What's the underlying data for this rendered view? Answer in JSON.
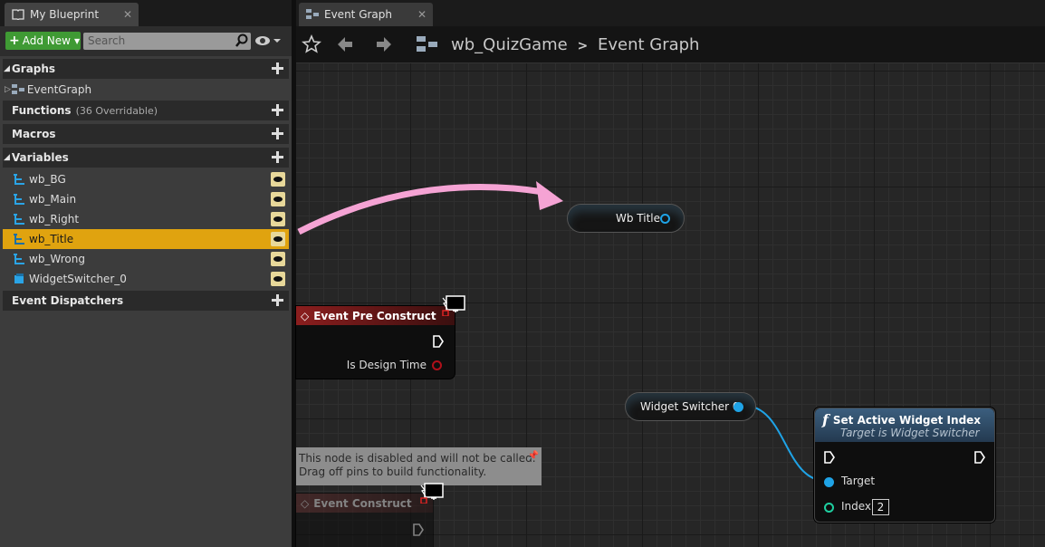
{
  "left_panel": {
    "tab_title": "My Blueprint",
    "add_new_label": "Add New",
    "search_placeholder": "Search",
    "categories": {
      "graphs": "Graphs",
      "functions": "Functions",
      "functions_overridable": "(36 Overridable)",
      "macros": "Macros",
      "variables": "Variables",
      "event_dispatchers": "Event Dispatchers"
    },
    "graph_items": [
      "EventGraph"
    ],
    "variables": [
      "wb_BG",
      "wb_Main",
      "wb_Right",
      "wb_Title",
      "wb_Wrong",
      "WidgetSwitcher_0"
    ],
    "selected_variable": "wb_Title"
  },
  "graph_tab": {
    "title": "Event Graph"
  },
  "breadcrumb": {
    "blueprint": "wb_QuizGame",
    "separator": ">",
    "graph": "Event Graph"
  },
  "nodes": {
    "wb_title_getter": "Wb Title",
    "pre_construct": {
      "title": "Event Pre Construct",
      "output": "Is Design Time"
    },
    "widget_switcher_getter": "Widget Switcher 0",
    "set_active": {
      "title": "Set Active Widget Index",
      "subtitle": "Target is Widget Switcher",
      "target_label": "Target",
      "index_label": "Index",
      "index_value": "2"
    },
    "event_construct": {
      "title": "Event Construct"
    },
    "disabled_comment_line1": "This node is disabled and will not be called.",
    "disabled_comment_line2": "Drag off pins to build functionality."
  },
  "colors": {
    "accent_selection": "#e0a30f",
    "add_new_green": "#3f9a34",
    "event_red": "#8b1e1e",
    "function_blue": "#3b5e7e",
    "object_pin_blue": "#1fa3e6",
    "exec_white": "#ffffff",
    "bool_pin_red": "#b0101a",
    "int_pin_green": "#1ecfa0",
    "annotation_pink": "#f5a3d4"
  }
}
